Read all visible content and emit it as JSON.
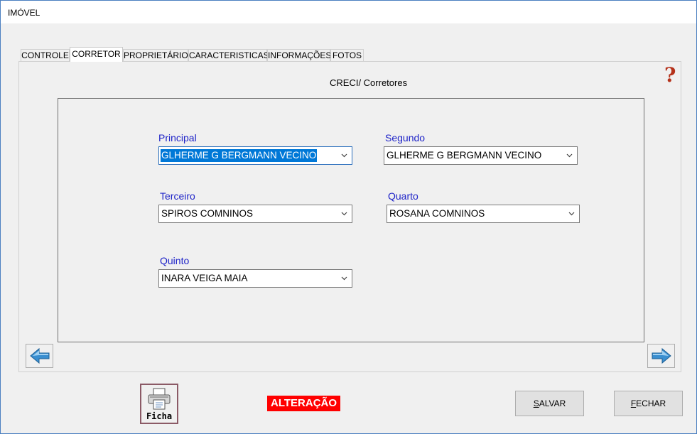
{
  "window": {
    "title": "IMÓVEL"
  },
  "tabs": [
    {
      "label": "CONTROLE"
    },
    {
      "label": "CORRETOR"
    },
    {
      "label": "PROPRIETÁRIO"
    },
    {
      "label": "CARACTERISTICAS"
    },
    {
      "label": "INFORMAÇÕES"
    },
    {
      "label": "FOTOS"
    }
  ],
  "panel": {
    "title": "CRECI/ Corretores",
    "help_icon": "question-mark-icon",
    "fields": {
      "principal": {
        "label": "Principal",
        "value": "GLHERME G BERGMANN VECINO"
      },
      "segundo": {
        "label": "Segundo",
        "value": "GLHERME G BERGMANN VECINO"
      },
      "terceiro": {
        "label": "Terceiro",
        "value": "SPIROS COMNINOS"
      },
      "quarto": {
        "label": "Quarto",
        "value": "ROSANA COMNINOS"
      },
      "quinto": {
        "label": "Quinto",
        "value": "INARA VEIGA MAIA"
      }
    }
  },
  "nav": {
    "prev_icon": "arrow-left-icon",
    "next_icon": "arrow-right-icon"
  },
  "footer": {
    "ficha_label": "Ficha",
    "status": "ALTERAÇÃO",
    "save_first": "S",
    "save_rest": "ALVAR",
    "close_first": "F",
    "close_rest": "ECHAR"
  },
  "colors": {
    "label_blue": "#1f24c8",
    "status_bg": "#ff0000",
    "selection": "#0078d7",
    "arrow_blue": "#3a8fd0",
    "help_red": "#b5311a"
  }
}
